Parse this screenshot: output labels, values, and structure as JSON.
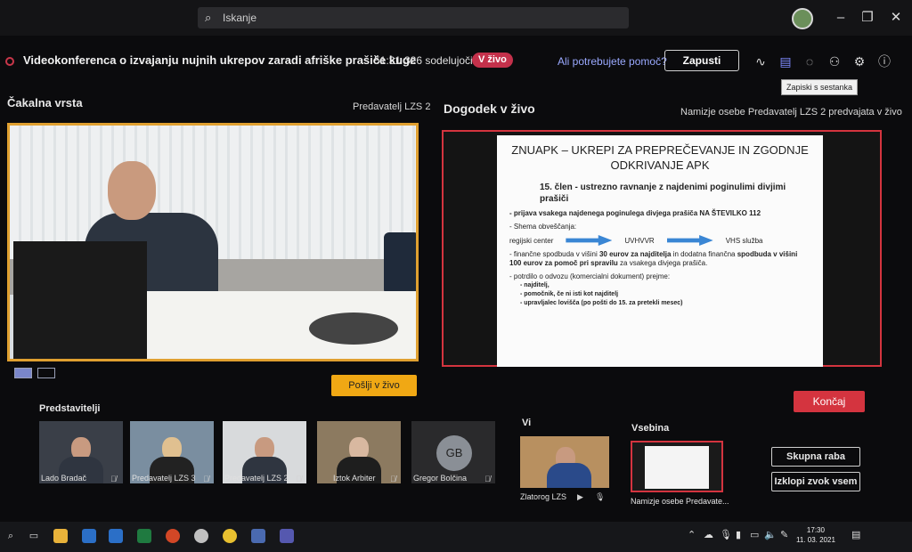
{
  "search": {
    "placeholder": "Iskanje"
  },
  "meeting": {
    "title": "Videokonferenca o izvajanju nujnih ukrepov zaradi afriške prašiče kuge",
    "time": "51:31",
    "participants": "326 sodelujočih",
    "live_badge": "V živo",
    "help_link": "Ali potrebujete pomoč?",
    "launch_button": "Zapusti",
    "tooltip": "Zapiski s sestanka"
  },
  "queue": {
    "title": "Čakalna vrsta",
    "presenter": "Predavatelj LZS 2",
    "send_live_button": "Pošlji v živo"
  },
  "live": {
    "title": "Dogodek v živo",
    "note": "Namizje osebe Predavatelj LZS 2 predvajata v živo",
    "end_button": "Končaj"
  },
  "slide": {
    "title": "ZNUAPK – UKREPI ZA PREPREČEVANJE IN ZGODNJE ODKRIVANJE APK",
    "subtitle": "15. člen - ustrezno ravnanje z najdenimi poginulimi divjimi prašiči",
    "item1": "- prijava vsakega najdenega poginulega divjega prašiča NA ŠTEVILKO 112",
    "item2": "- Shema obveščanja:",
    "flow": [
      "regijski center",
      "UVHVVR",
      "VHS služba"
    ],
    "item3a": "- finančne spodbuda v višini ",
    "item3b": "30 eurov za najditelja",
    "item3c": " in dodatna finančna ",
    "item3d": "spodbuda v višini 100 eurov za pomoč pri spravilu",
    "item3e": " za vsakega divjega prašiča.",
    "item4": "- potrdilo o odvozu (komercialni dokument) prejme:",
    "sub": [
      "najditelj,",
      "pomočnik,  če ni isti kot najditelj",
      "upravljalec lovišča (po pošti do 15. za pretekli mesec)"
    ]
  },
  "representatives": {
    "title": "Predstavitelji",
    "tiles": [
      {
        "name": "Lado Bradač"
      },
      {
        "name": "Predavatelj LZS 3"
      },
      {
        "name": "Predavatelj LZS 2"
      },
      {
        "name": "Iztok Arbiter"
      },
      {
        "name": "Gregor Bolčina",
        "initials": "GB"
      }
    ]
  },
  "self": {
    "title": "Vi",
    "name": "Zlatorog LZS"
  },
  "content": {
    "title": "Vsebina",
    "name": "Namizje osebe Predavate..."
  },
  "side": {
    "share_button": "Skupna raba",
    "mute_all_button": "Izklopi zvok vsem"
  },
  "taskbar": {
    "time": "17:30",
    "date": "11. 03. 2021"
  },
  "colors": {
    "live_red": "#d4343f",
    "queue_orange": "#e0a030",
    "send_yellow": "#f0a814"
  }
}
